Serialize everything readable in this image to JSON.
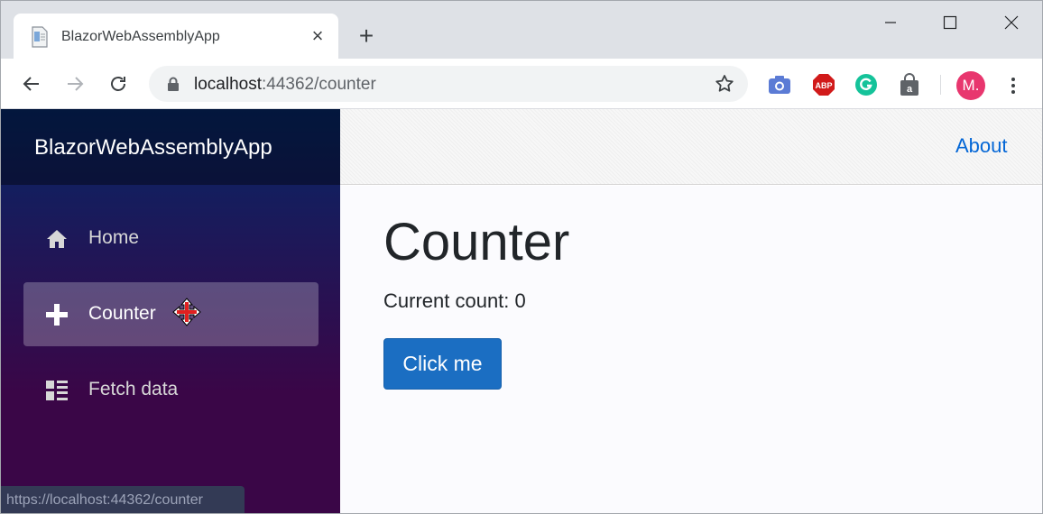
{
  "browser": {
    "tab_title": "BlazorWebAssemblyApp",
    "url_host": "localhost",
    "url_rest": ":44362/counter",
    "avatar_initial": "M.",
    "extensions": [
      "camera-icon",
      "adblock-icon",
      "grammarly-icon",
      "shopping-bag-icon"
    ]
  },
  "app": {
    "brand": "BlazorWebAssemblyApp",
    "nav": [
      {
        "label": "Home",
        "icon": "home-icon"
      },
      {
        "label": "Counter",
        "icon": "plus-icon",
        "active": true
      },
      {
        "label": "Fetch data",
        "icon": "list-icon"
      }
    ],
    "about_link": "About"
  },
  "main": {
    "title": "Counter",
    "count_label": "Current count: 0",
    "button_label": "Click me"
  },
  "status_url": "https://localhost:44362/counter",
  "colors": {
    "accent": "#1b6ec2",
    "link": "#0366d6",
    "sidebar_top": "#052767",
    "sidebar_bottom": "#3a0647"
  }
}
